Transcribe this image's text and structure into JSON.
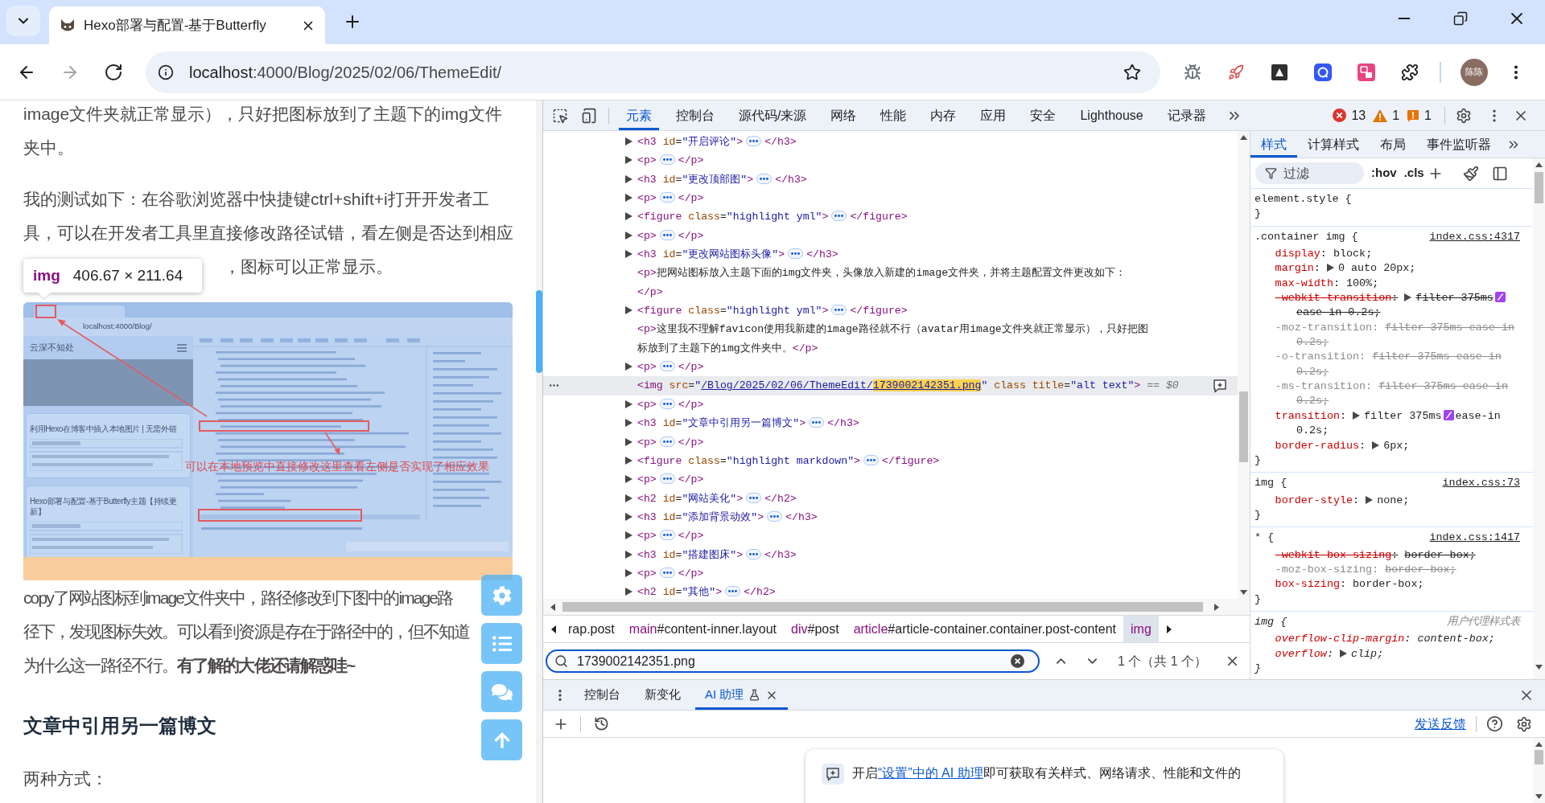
{
  "browser": {
    "tab": {
      "title": "Hexo部署与配置-基于Butterfly"
    },
    "navigation": [
      {
        "kind": "back",
        "disabled": false
      },
      {
        "kind": "forward",
        "disabled": true
      },
      {
        "kind": "reload",
        "disabled": false
      }
    ],
    "address": {
      "host": "localhost",
      "path": ":4000/Blog/2025/02/06/ThemeEdit/"
    },
    "profile": {
      "initials": "陈陈"
    }
  },
  "article": {
    "blocks": [
      {
        "kind": "paragraph",
        "lines": [
          "image文件夹就正常显示），只好把图标放到了主题下的img文件",
          "夹中。"
        ]
      },
      {
        "kind": "paragraph",
        "lines": [
          "我的测试如下：在谷歌浏览器中快捷键ctrl+shift+i打开开发者工",
          "具，可以在开发者工具里直接修改路径试错，看左侧是否达到相应",
          "，图标可以正常显示。"
        ],
        "overlaid_last_line": true
      },
      {
        "kind": "figure",
        "tooltip": {
          "tag": "img",
          "size": "406.67 × 211.64"
        },
        "margin_highlight": true,
        "screenshot": {
          "address": "localhost:4000/Blog/",
          "site_title": "云深不知处",
          "posts": [
            "利用Hexo在博客中插入本地图片 | 无需外链",
            "Hexo部署与配置-基于Butterfly主题【持续更新】"
          ],
          "annotation": "可以在本地预览中直接修改这里查看左侧是否实现了相应效果"
        }
      },
      {
        "kind": "paragraph",
        "lines": [
          "copy了网站图标到image文件夹中，路径修改到下图中的image路",
          "径下，发现图标失效。可以看到资源是存在于路径中的，但不知道",
          "为什么这一路径不行。**有了解的大佬还请解惑哇~**"
        ]
      },
      {
        "kind": "heading",
        "text": "文章中引用另一篇博文"
      },
      {
        "kind": "paragraph",
        "lines": [
          "两种方式："
        ]
      }
    ]
  },
  "devtools": {
    "tabs": [
      {
        "label": "元素",
        "selected": true
      },
      {
        "label": "控制台",
        "selected": false
      },
      {
        "label": "源代码/来源",
        "selected": false
      },
      {
        "label": "网络",
        "selected": false
      },
      {
        "label": "性能",
        "selected": false
      },
      {
        "label": "内存",
        "selected": false
      },
      {
        "label": "应用",
        "selected": false
      },
      {
        "label": "安全",
        "selected": false
      },
      {
        "label": "Lighthouse",
        "selected": false
      },
      {
        "label": "记录器",
        "selected": false
      }
    ],
    "issues": [
      {
        "kind": "error",
        "count": "13"
      },
      {
        "kind": "warning",
        "count": "1"
      },
      {
        "kind": "info",
        "count": "1"
      }
    ],
    "dom_tree": [
      {
        "kind": "collapsed",
        "selected": false,
        "segments": [
          {
            "kind": "tag",
            "text": "<h3"
          },
          {
            "kind": "attr",
            "text": " id"
          },
          {
            "kind": "punct",
            "text": "="
          },
          {
            "kind": "value",
            "text": "\"开启评论\""
          },
          {
            "kind": "tag",
            "text": ">"
          },
          {
            "kind": "ellipsis"
          },
          {
            "kind": "tag",
            "text": "</h3>"
          }
        ]
      },
      {
        "kind": "collapsed",
        "selected": false,
        "segments": [
          {
            "kind": "tag",
            "text": "<p>"
          },
          {
            "kind": "ellipsis"
          },
          {
            "kind": "tag",
            "text": "</p>"
          }
        ]
      },
      {
        "kind": "collapsed",
        "selected": false,
        "segments": [
          {
            "kind": "tag",
            "text": "<h3"
          },
          {
            "kind": "attr",
            "text": " id"
          },
          {
            "kind": "punct",
            "text": "="
          },
          {
            "kind": "value",
            "text": "\"更改顶部图\""
          },
          {
            "kind": "tag",
            "text": ">"
          },
          {
            "kind": "ellipsis"
          },
          {
            "kind": "tag",
            "text": "</h3>"
          }
        ]
      },
      {
        "kind": "collapsed",
        "selected": false,
        "segments": [
          {
            "kind": "tag",
            "text": "<p>"
          },
          {
            "kind": "ellipsis"
          },
          {
            "kind": "tag",
            "text": "</p>"
          }
        ]
      },
      {
        "kind": "collapsed",
        "selected": false,
        "segments": [
          {
            "kind": "tag",
            "text": "<figure"
          },
          {
            "kind": "attr",
            "text": " class"
          },
          {
            "kind": "punct",
            "text": "="
          },
          {
            "kind": "value",
            "text": "\"highlight yml\""
          },
          {
            "kind": "tag",
            "text": ">"
          },
          {
            "kind": "ellipsis"
          },
          {
            "kind": "tag",
            "text": "</figure>"
          }
        ]
      },
      {
        "kind": "collapsed",
        "selected": false,
        "segments": [
          {
            "kind": "tag",
            "text": "<p>"
          },
          {
            "kind": "ellipsis"
          },
          {
            "kind": "tag",
            "text": "</p>"
          }
        ]
      },
      {
        "kind": "collapsed",
        "selected": false,
        "segments": [
          {
            "kind": "tag",
            "text": "<h3"
          },
          {
            "kind": "attr",
            "text": " id"
          },
          {
            "kind": "punct",
            "text": "="
          },
          {
            "kind": "value",
            "text": "\"更改网站图标头像\""
          },
          {
            "kind": "tag",
            "text": ">"
          },
          {
            "kind": "ellipsis"
          },
          {
            "kind": "tag",
            "text": "</h3>"
          }
        ]
      },
      {
        "kind": "text",
        "selected": false,
        "segments": [
          {
            "kind": "tag",
            "text": "<p>"
          },
          {
            "kind": "text",
            "text": "把网站图标放入主题下面的img文件夹，头像放入新建的image文件夹，并将主题配置文件更改如下："
          },
          {
            "kind": "tag",
            "text": "</p>"
          }
        ]
      },
      {
        "kind": "collapsed",
        "selected": false,
        "segments": [
          {
            "kind": "tag",
            "text": "<figure"
          },
          {
            "kind": "attr",
            "text": " class"
          },
          {
            "kind": "punct",
            "text": "="
          },
          {
            "kind": "value",
            "text": "\"highlight yml\""
          },
          {
            "kind": "tag",
            "text": ">"
          },
          {
            "kind": "ellipsis"
          },
          {
            "kind": "tag",
            "text": "</figure>"
          }
        ]
      },
      {
        "kind": "text",
        "selected": false,
        "segments": [
          {
            "kind": "tag",
            "text": "<p>"
          },
          {
            "kind": "text",
            "text": "这里我不理解favicon使用我新建的image路径就不行（avatar用image文件夹就正常显示），只好把图标放到了主题下的img文件夹中。"
          },
          {
            "kind": "tag",
            "text": "</p>"
          }
        ]
      },
      {
        "kind": "collapsed",
        "selected": false,
        "segments": [
          {
            "kind": "tag",
            "text": "<p>"
          },
          {
            "kind": "ellipsis"
          },
          {
            "kind": "tag",
            "text": "</p>"
          }
        ]
      },
      {
        "kind": "leaf",
        "selected": true,
        "segments": [
          {
            "kind": "tag",
            "text": "<img"
          },
          {
            "kind": "attr",
            "text": " src"
          },
          {
            "kind": "punct",
            "text": "="
          },
          {
            "kind": "value",
            "text": "\""
          },
          {
            "kind": "link",
            "text": "/Blog/2025/02/06/ThemeEdit/"
          },
          {
            "kind": "match",
            "text": "1739002142351.png"
          },
          {
            "kind": "value",
            "text": "\""
          },
          {
            "kind": "attr",
            "text": " class"
          },
          {
            "kind": "attr",
            "text": " title"
          },
          {
            "kind": "punct",
            "text": "="
          },
          {
            "kind": "value",
            "text": "\"alt text\""
          },
          {
            "kind": "tag",
            "text": ">"
          },
          {
            "kind": "ref",
            "text": " == $0"
          }
        ]
      },
      {
        "kind": "collapsed",
        "selected": false,
        "segments": [
          {
            "kind": "tag",
            "text": "<p>"
          },
          {
            "kind": "ellipsis"
          },
          {
            "kind": "tag",
            "text": "</p>"
          }
        ]
      },
      {
        "kind": "collapsed",
        "selected": false,
        "segments": [
          {
            "kind": "tag",
            "text": "<h3"
          },
          {
            "kind": "attr",
            "text": " id"
          },
          {
            "kind": "punct",
            "text": "="
          },
          {
            "kind": "value",
            "text": "\"文章中引用另一篇博文\""
          },
          {
            "kind": "tag",
            "text": ">"
          },
          {
            "kind": "ellipsis"
          },
          {
            "kind": "tag",
            "text": "</h3>"
          }
        ]
      },
      {
        "kind": "collapsed",
        "selected": false,
        "segments": [
          {
            "kind": "tag",
            "text": "<p>"
          },
          {
            "kind": "ellipsis"
          },
          {
            "kind": "tag",
            "text": "</p>"
          }
        ]
      },
      {
        "kind": "collapsed",
        "selected": false,
        "segments": [
          {
            "kind": "tag",
            "text": "<figure"
          },
          {
            "kind": "attr",
            "text": " class"
          },
          {
            "kind": "punct",
            "text": "="
          },
          {
            "kind": "value",
            "text": "\"highlight markdown\""
          },
          {
            "kind": "tag",
            "text": ">"
          },
          {
            "kind": "ellipsis"
          },
          {
            "kind": "tag",
            "text": "</figure>"
          }
        ]
      },
      {
        "kind": "collapsed",
        "selected": false,
        "segments": [
          {
            "kind": "tag",
            "text": "<p>"
          },
          {
            "kind": "ellipsis"
          },
          {
            "kind": "tag",
            "text": "</p>"
          }
        ]
      },
      {
        "kind": "collapsed",
        "selected": false,
        "segments": [
          {
            "kind": "tag",
            "text": "<h2"
          },
          {
            "kind": "attr",
            "text": " id"
          },
          {
            "kind": "punct",
            "text": "="
          },
          {
            "kind": "value",
            "text": "\"网站美化\""
          },
          {
            "kind": "tag",
            "text": ">"
          },
          {
            "kind": "ellipsis"
          },
          {
            "kind": "tag",
            "text": "</h2>"
          }
        ]
      },
      {
        "kind": "collapsed",
        "selected": false,
        "segments": [
          {
            "kind": "tag",
            "text": "<h3"
          },
          {
            "kind": "attr",
            "text": " id"
          },
          {
            "kind": "punct",
            "text": "="
          },
          {
            "kind": "value",
            "text": "\"添加背景动效\""
          },
          {
            "kind": "tag",
            "text": ">"
          },
          {
            "kind": "ellipsis"
          },
          {
            "kind": "tag",
            "text": "</h3>"
          }
        ]
      },
      {
        "kind": "collapsed",
        "selected": false,
        "segments": [
          {
            "kind": "tag",
            "text": "<p>"
          },
          {
            "kind": "ellipsis"
          },
          {
            "kind": "tag",
            "text": "</p>"
          }
        ]
      },
      {
        "kind": "collapsed",
        "selected": false,
        "segments": [
          {
            "kind": "tag",
            "text": "<h3"
          },
          {
            "kind": "attr",
            "text": " id"
          },
          {
            "kind": "punct",
            "text": "="
          },
          {
            "kind": "value",
            "text": "\"搭建图床\""
          },
          {
            "kind": "tag",
            "text": ">"
          },
          {
            "kind": "ellipsis"
          },
          {
            "kind": "tag",
            "text": "</h3>"
          }
        ]
      },
      {
        "kind": "collapsed",
        "selected": false,
        "segments": [
          {
            "kind": "tag",
            "text": "<p>"
          },
          {
            "kind": "ellipsis"
          },
          {
            "kind": "tag",
            "text": "</p>"
          }
        ]
      },
      {
        "kind": "collapsed",
        "selected": false,
        "segments": [
          {
            "kind": "tag",
            "text": "<h2"
          },
          {
            "kind": "attr",
            "text": " id"
          },
          {
            "kind": "punct",
            "text": "="
          },
          {
            "kind": "value",
            "text": "\"其他\""
          },
          {
            "kind": "tag",
            "text": ">"
          },
          {
            "kind": "ellipsis"
          },
          {
            "kind": "tag",
            "text": "</h2>"
          }
        ]
      }
    ],
    "breadcrumbs": [
      {
        "rest": "rap.post",
        "selected": false
      },
      {
        "tag": "main",
        "rest": "#content-inner.layout",
        "selected": false
      },
      {
        "tag": "div",
        "rest": "#post",
        "selected": false
      },
      {
        "tag": "article",
        "rest": "#article-container.container.post-content",
        "selected": false
      },
      {
        "tag": "img",
        "selected": true
      }
    ],
    "search": {
      "value": "1739002142351.png",
      "result": "1 个（共 1 个）"
    },
    "styles": {
      "tabs": [
        {
          "label": "样式",
          "selected": true
        },
        {
          "label": "计算样式",
          "selected": false
        },
        {
          "label": "布局",
          "selected": false
        },
        {
          "label": "事件监听器",
          "selected": false
        }
      ],
      "filter": {
        "placeholder": "过滤"
      },
      "toggles": [
        ":hov",
        ".cls"
      ],
      "rules": [
        {
          "kind": "inline",
          "selector": "element.style {",
          "close": "}"
        },
        {
          "kind": "author",
          "selector": ".container img {",
          "source": "index.css:4317",
          "declarations": [
            {
              "name": "display",
              "colon": ":",
              "value": "block;",
              "overridden": false,
              "unsupported": false
            },
            {
              "name": "margin",
              "colon": ":",
              "value": "0 auto 20px;",
              "overridden": false,
              "unsupported": false,
              "expandable": true
            },
            {
              "name": "max-width",
              "colon": ":",
              "value": "100%;",
              "overridden": false,
              "unsupported": false
            },
            {
              "name": "-webkit-transition",
              "colon": ":",
              "value": "filter 375ms",
              "easing": "ease-in 0.2s;",
              "overridden": true,
              "unsupported": false,
              "expandable": true
            },
            {
              "name": "-moz-transition",
              "colon": ":",
              "value": "filter 375ms ease-in 0.2s;",
              "overridden": false,
              "unsupported": true
            },
            {
              "name": "-o-transition",
              "colon": ":",
              "value": "filter 375ms ease-in 0.2s;",
              "overridden": false,
              "unsupported": true
            },
            {
              "name": "-ms-transition",
              "colon": ":",
              "value": "filter 375ms ease-in 0.2s;",
              "overridden": false,
              "unsupported": true
            },
            {
              "name": "transition",
              "colon": ":",
              "value": "filter 375ms",
              "easing": "ease-in 0.2s;",
              "overridden": false,
              "unsupported": false,
              "expandable": true
            },
            {
              "name": "border-radius",
              "colon": ":",
              "value": "6px;",
              "overridden": false,
              "unsupported": false,
              "expandable": true
            }
          ],
          "close": "}"
        },
        {
          "kind": "author",
          "selector": "img {",
          "source": "index.css:73",
          "declarations": [
            {
              "name": "border-style",
              "colon": ":",
              "value": "none;",
              "overridden": false,
              "unsupported": false,
              "expandable": true
            }
          ],
          "close": "}"
        },
        {
          "kind": "author",
          "selector": "* {",
          "source": "index.css:1417",
          "declarations": [
            {
              "name": "-webkit-box-sizing",
              "colon": ":",
              "value": "border-box;",
              "overridden": true,
              "unsupported": false
            },
            {
              "name": "-moz-box-sizing",
              "colon": ":",
              "value": "border-box;",
              "overridden": false,
              "unsupported": true
            },
            {
              "name": "box-sizing",
              "colon": ":",
              "value": "border-box;",
              "overridden": false,
              "unsupported": false
            }
          ],
          "close": "}"
        },
        {
          "kind": "user-agent",
          "selector": "img {",
          "source": "用户代理样式表",
          "declarations": [
            {
              "name": "overflow-clip-margin",
              "colon": ":",
              "value": "content-box;",
              "overridden": false,
              "unsupported": false
            },
            {
              "name": "overflow",
              "colon": ":",
              "value": "clip;",
              "overridden": false,
              "unsupported": false,
              "expandable": true
            }
          ],
          "close": "}"
        }
      ]
    },
    "drawer": {
      "tabs": [
        {
          "label": "控制台",
          "selected": false,
          "experimental": false,
          "closable": false
        },
        {
          "label": "新变化",
          "selected": false,
          "experimental": false,
          "closable": false
        },
        {
          "label": "AI 助理",
          "selected": true,
          "experimental": true,
          "closable": true
        }
      ],
      "feedback_link": "发送反馈",
      "notice": {
        "lead": "开启",
        "link": "“设置”中的 AI 助理",
        "rest": "即可获取有关样式、网络请求、性能和文件的"
      }
    }
  }
}
